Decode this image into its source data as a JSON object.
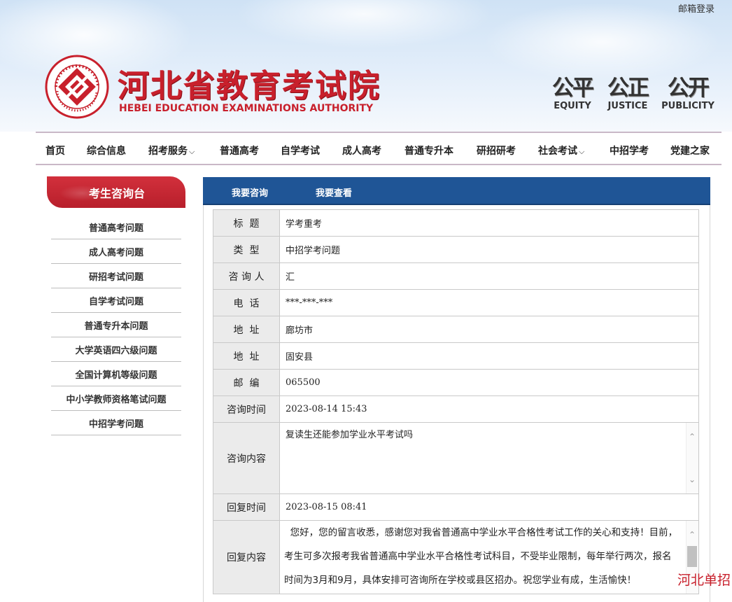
{
  "header": {
    "mail_login": "邮箱登录",
    "title": "河北省教育考试院",
    "subtitle": "HEBEI EDUCATION EXAMINATIONS AUTHORITY",
    "seal_text": "HEBEI EDUCATION EXAMINATIONS AUTHORITY",
    "values": [
      {
        "han": "公平",
        "en": "EQUITY"
      },
      {
        "han": "公正",
        "en": "JUSTICE"
      },
      {
        "han": "公开",
        "en": "PUBLICITY"
      }
    ]
  },
  "nav": {
    "items": [
      {
        "label": "首页"
      },
      {
        "label": "综合信息"
      },
      {
        "label": "招考服务",
        "caret": "⌵"
      },
      {
        "label": "普通高考"
      },
      {
        "label": "自学考试"
      },
      {
        "label": "成人高考"
      },
      {
        "label": "普通专升本"
      },
      {
        "label": "研招研考"
      },
      {
        "label": "社会考试",
        "caret": "⌵"
      },
      {
        "label": "中招学考"
      },
      {
        "label": "党建之家"
      }
    ]
  },
  "sidebar": {
    "title": "考生咨询台",
    "items": [
      {
        "label": "普通高考问题"
      },
      {
        "label": "成人高考问题"
      },
      {
        "label": "研招考试问题"
      },
      {
        "label": "自学考试问题"
      },
      {
        "label": "普通专升本问题"
      },
      {
        "label": "大学英语四六级问题"
      },
      {
        "label": "全国计算机等级问题"
      },
      {
        "label": "中小学教师资格笔试问题"
      },
      {
        "label": "中招学考问题"
      }
    ]
  },
  "tabs": {
    "consult": "我要咨询",
    "check": "我要查看"
  },
  "detail": {
    "title_label": "标  题",
    "title_value": "学考重考",
    "type_label": "类  型",
    "type_value": "中招学考问题",
    "person_label": "咨 询 人",
    "person_value": "汇",
    "phone_label": "电  话",
    "phone_value": "***-***-***",
    "address1_label": "地  址",
    "address1_value": "廊坊市",
    "address2_label": "地  址",
    "address2_value": "固安县",
    "zip_label": "邮  编",
    "zip_value": "065500",
    "consult_time_label": "咨询时间",
    "consult_time_value": "2023-08-14 15:43",
    "content_label": "咨询内容",
    "content_value": "复读生还能参加学业水平考试吗",
    "reply_time_label": "回复时间",
    "reply_time_value": "2023-08-15 08:41",
    "reply_label": "回复内容",
    "reply_value": "  您好，您的留言收悉，感谢您对我省普通高中学业水平合格性考试工作的关心和支持！目前，考生可多次报考我省普通高中学业水平合格性考试科目，不受毕业限制，每年举行两次，报名时间为3月和9月，具体安排可咨询所在学校或县区招办。祝您学业有成，生活愉快！"
  },
  "watermark": "河北单招",
  "colors": {
    "brand_red": "#c8202c",
    "nav_blue": "#1f5596"
  }
}
